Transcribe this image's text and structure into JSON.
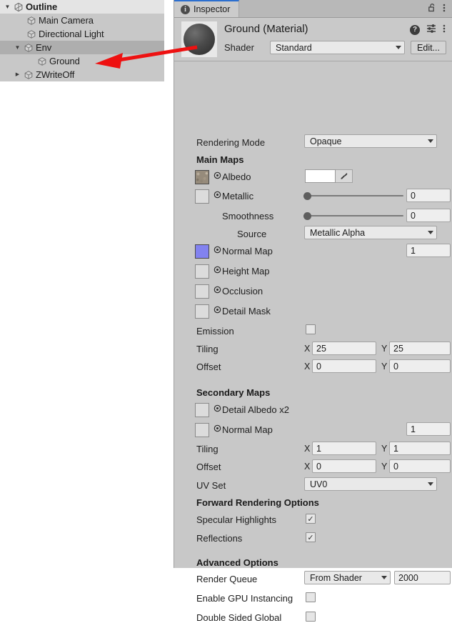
{
  "hierarchy": {
    "panel_name": "Outline",
    "rows": [
      {
        "label": "Outline",
        "depth": 0,
        "twisty": "▼",
        "icon": "unity-logo-icon",
        "selected": false,
        "header": true
      },
      {
        "label": "Main Camera",
        "depth": 1,
        "twisty": "",
        "icon": "gameobject-cube-icon",
        "selected": false,
        "header": false
      },
      {
        "label": "Directional Light",
        "depth": 1,
        "twisty": "",
        "icon": "gameobject-cube-icon",
        "selected": false,
        "header": false
      },
      {
        "label": "Env",
        "depth": 1,
        "twisty": "▼",
        "icon": "gameobject-cube-icon",
        "selected": true,
        "header": false
      },
      {
        "label": "Ground",
        "depth": 2,
        "twisty": "",
        "icon": "gameobject-cube-icon",
        "selected": false,
        "header": false
      },
      {
        "label": "ZWriteOff",
        "depth": 1,
        "twisty": "▶",
        "icon": "gameobject-cube-icon",
        "selected": false,
        "header": false
      }
    ]
  },
  "inspector": {
    "tab_label": "Inspector",
    "tab_icon": "info-icon",
    "lock_icon": "lock-open-icon",
    "tab_menu_icon": "kebab-menu-icon",
    "object_title": "Ground (Material)",
    "preview_icon": "material-sphere-preview",
    "help_icon": "help-icon",
    "preset_icon": "preset-sliders-icon",
    "menu_icon": "kebab-menu-icon",
    "shader": {
      "label": "Shader",
      "value": "Standard",
      "edit_label": "Edit..."
    },
    "rendering_mode": {
      "label": "Rendering Mode",
      "value": "Opaque"
    },
    "main_maps": {
      "title": "Main Maps",
      "albedo": {
        "label": "Albedo",
        "color": "#ffffff",
        "eyedropper_icon": "eyedropper-icon",
        "has_texture": true
      },
      "metallic": {
        "label": "Metallic",
        "value": "0",
        "has_texture": false
      },
      "smoothness": {
        "label": "Smoothness",
        "value": "0"
      },
      "source": {
        "label": "Source",
        "value": "Metallic Alpha"
      },
      "normal_map": {
        "label": "Normal Map",
        "value": "1",
        "has_texture": true
      },
      "height_map": {
        "label": "Height Map",
        "has_texture": false
      },
      "occlusion": {
        "label": "Occlusion",
        "has_texture": false
      },
      "detail_mask": {
        "label": "Detail Mask",
        "has_texture": false
      },
      "emission": {
        "label": "Emission",
        "checked": false
      },
      "tiling": {
        "label": "Tiling",
        "x_letter": "X",
        "x": "25",
        "y_letter": "Y",
        "y": "25"
      },
      "offset": {
        "label": "Offset",
        "x_letter": "X",
        "x": "0",
        "y_letter": "Y",
        "y": "0"
      }
    },
    "secondary_maps": {
      "title": "Secondary Maps",
      "detail_albedo": {
        "label": "Detail Albedo x2",
        "has_texture": false
      },
      "normal_map": {
        "label": "Normal Map",
        "value": "1",
        "has_texture": false
      },
      "tiling": {
        "label": "Tiling",
        "x_letter": "X",
        "x": "1",
        "y_letter": "Y",
        "y": "1"
      },
      "offset": {
        "label": "Offset",
        "x_letter": "X",
        "x": "0",
        "y_letter": "Y",
        "y": "0"
      },
      "uv_set": {
        "label": "UV Set",
        "value": "UV0"
      }
    },
    "forward_rendering": {
      "title": "Forward Rendering Options",
      "specular_highlights": {
        "label": "Specular Highlights",
        "checked": true,
        "mark": "✓"
      },
      "reflections": {
        "label": "Reflections",
        "checked": true,
        "mark": "✓"
      }
    },
    "advanced": {
      "title": "Advanced Options",
      "render_queue": {
        "label": "Render Queue",
        "mode": "From Shader",
        "value": "2000"
      },
      "gpu_instancing": {
        "label": "Enable GPU Instancing",
        "checked": false
      },
      "double_sided": {
        "label": "Double Sided Global",
        "checked": false
      }
    }
  },
  "annotation": {
    "arrow_color": "#ee1111",
    "arrow_name": "red-pointer-arrow"
  },
  "colors": {
    "panel_bg": "#c8c8c8",
    "selected_row": "#aeaeae",
    "accent_tab": "#2c6fcf",
    "normal_map_swatch": "#8282f0"
  }
}
